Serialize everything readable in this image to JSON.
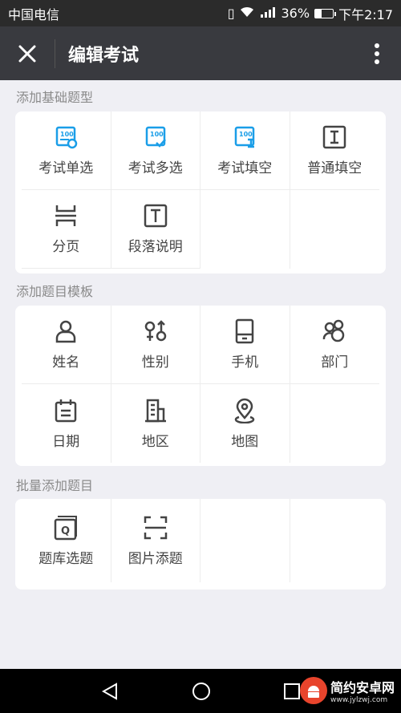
{
  "status_bar": {
    "carrier": "中国电信",
    "battery_pct": "36%",
    "time": "下午2:17",
    "battery_level": 0.36
  },
  "app_bar": {
    "title": "编辑考试"
  },
  "sections": [
    {
      "label": "添加基础题型",
      "items": [
        {
          "label": "考试单选",
          "icon": "exam-single-choice-icon"
        },
        {
          "label": "考试多选",
          "icon": "exam-multi-choice-icon"
        },
        {
          "label": "考试填空",
          "icon": "exam-fill-blank-icon"
        },
        {
          "label": "普通填空",
          "icon": "text-field-icon"
        },
        {
          "label": "分页",
          "icon": "page-break-icon"
        },
        {
          "label": "段落说明",
          "icon": "paragraph-icon"
        }
      ]
    },
    {
      "label": "添加题目模板",
      "items": [
        {
          "label": "姓名",
          "icon": "person-icon"
        },
        {
          "label": "性别",
          "icon": "gender-icon"
        },
        {
          "label": "手机",
          "icon": "phone-icon"
        },
        {
          "label": "部门",
          "icon": "group-icon"
        },
        {
          "label": "日期",
          "icon": "calendar-icon"
        },
        {
          "label": "地区",
          "icon": "building-icon"
        },
        {
          "label": "地图",
          "icon": "map-pin-icon"
        }
      ]
    },
    {
      "label": "批量添加题目",
      "items": [
        {
          "label": "题库选题",
          "icon": "question-bank-icon"
        },
        {
          "label": "图片添题",
          "icon": "scan-icon"
        }
      ]
    }
  ],
  "colors": {
    "accent_blue": "#1a9ee8",
    "icon_dark": "#444444",
    "app_bar": "#393a3f"
  },
  "watermark": {
    "title": "简约安卓网",
    "url": "www.jylzwj.com"
  }
}
